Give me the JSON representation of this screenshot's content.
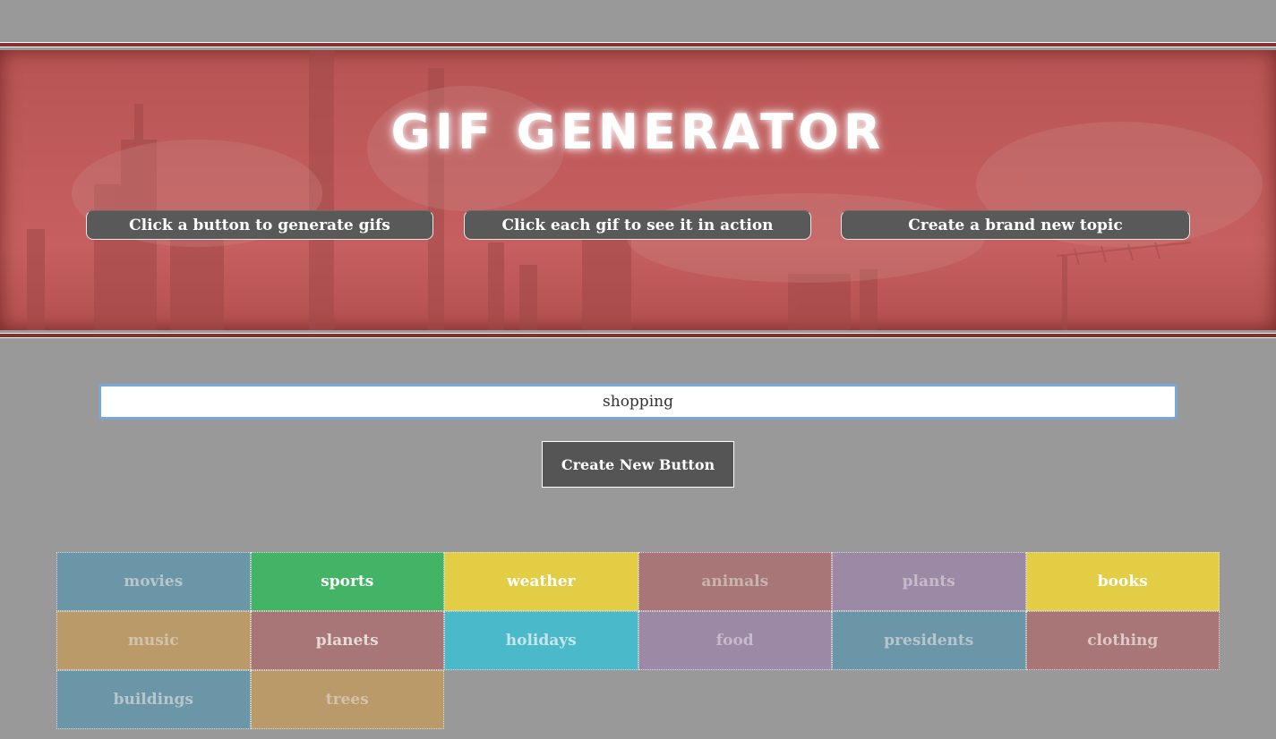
{
  "header": {
    "title": "GIF GENERATOR",
    "instructions": [
      "Click a button to generate gifs",
      "Click each gif to see it in action",
      "Create a brand new topic"
    ]
  },
  "form": {
    "input_value": "shopping",
    "submit_label": "Create New Button"
  },
  "topics": [
    {
      "label": "movies",
      "bg": "#6a96a8",
      "fg": "#b7c6cc"
    },
    {
      "label": "sports",
      "bg": "#43b366",
      "fg": "#ffffff"
    },
    {
      "label": "weather",
      "bg": "#e2cd44",
      "fg": "#ffffff"
    },
    {
      "label": "animals",
      "bg": "#a87676",
      "fg": "#c8b4b4"
    },
    {
      "label": "plants",
      "bg": "#9c89a6",
      "fg": "#c4bcc8"
    },
    {
      "label": "books",
      "bg": "#e2cd44",
      "fg": "#ffffff"
    },
    {
      "label": "music",
      "bg": "#b99a68",
      "fg": "#d2c4ac"
    },
    {
      "label": "planets",
      "bg": "#a87676",
      "fg": "#e6dada"
    },
    {
      "label": "holidays",
      "bg": "#4ab9c9",
      "fg": "#c6e6ea"
    },
    {
      "label": "food",
      "bg": "#9c89a6",
      "fg": "#c4bcc8"
    },
    {
      "label": "presidents",
      "bg": "#6a96a8",
      "fg": "#b7c6cc"
    },
    {
      "label": "clothing",
      "bg": "#a87676",
      "fg": "#dcc8c8"
    },
    {
      "label": "buildings",
      "bg": "#6a96a8",
      "fg": "#b7c6cc"
    },
    {
      "label": "trees",
      "bg": "#b99a68",
      "fg": "#d2c4ac"
    }
  ]
}
